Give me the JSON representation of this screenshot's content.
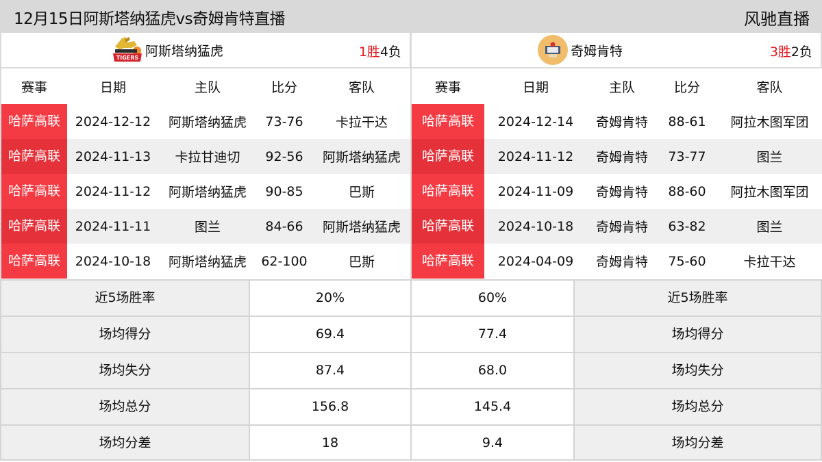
{
  "header": {
    "title": "12月15日阿斯塔纳猛虎vs奇姆肯特直播",
    "brand": "风驰直播"
  },
  "teams": {
    "left": {
      "name": "阿斯塔纳猛虎",
      "logo_icon": "astana-tigers-logo-icon",
      "record_win": "1胜",
      "record_loss": "4负"
    },
    "right": {
      "name": "奇姆肯特",
      "logo_icon": "shymkent-logo-icon",
      "record_win": "3胜",
      "record_loss": "2负"
    }
  },
  "colors": {
    "league_badge": "#f43b43",
    "win_text": "#e8141b",
    "header_bg": "#d9d9d9",
    "alt_row": "#efefef"
  },
  "columns": [
    "赛事",
    "日期",
    "主队",
    "比分",
    "客队"
  ],
  "left_matches": [
    {
      "league": "哈萨高联",
      "date": "2024-12-12",
      "home": "阿斯塔纳猛虎",
      "score": "73-76",
      "away": "卡拉干达"
    },
    {
      "league": "哈萨高联",
      "date": "2024-11-13",
      "home": "卡拉甘迪切",
      "score": "92-56",
      "away": "阿斯塔纳猛虎"
    },
    {
      "league": "哈萨高联",
      "date": "2024-11-12",
      "home": "阿斯塔纳猛虎",
      "score": "90-85",
      "away": "巴斯"
    },
    {
      "league": "哈萨高联",
      "date": "2024-11-11",
      "home": "图兰",
      "score": "84-66",
      "away": "阿斯塔纳猛虎"
    },
    {
      "league": "哈萨高联",
      "date": "2024-10-18",
      "home": "阿斯塔纳猛虎",
      "score": "62-100",
      "away": "巴斯"
    }
  ],
  "right_matches": [
    {
      "league": "哈萨高联",
      "date": "2024-12-14",
      "home": "奇姆肯特",
      "score": "88-61",
      "away": "阿拉木图军团"
    },
    {
      "league": "哈萨高联",
      "date": "2024-11-12",
      "home": "奇姆肯特",
      "score": "73-77",
      "away": "图兰"
    },
    {
      "league": "哈萨高联",
      "date": "2024-11-09",
      "home": "奇姆肯特",
      "score": "88-60",
      "away": "阿拉木图军团"
    },
    {
      "league": "哈萨高联",
      "date": "2024-10-18",
      "home": "奇姆肯特",
      "score": "63-82",
      "away": "图兰"
    },
    {
      "league": "哈萨高联",
      "date": "2024-04-09",
      "home": "奇姆肯特",
      "score": "75-60",
      "away": "卡拉干达"
    }
  ],
  "stats": [
    {
      "label": "近5场胜率",
      "left": "20%",
      "right": "60%"
    },
    {
      "label": "场均得分",
      "left": "69.4",
      "right": "77.4"
    },
    {
      "label": "场均失分",
      "left": "87.4",
      "right": "68.0"
    },
    {
      "label": "场均总分",
      "left": "156.8",
      "right": "145.4"
    },
    {
      "label": "场均分差",
      "left": "18",
      "right": "9.4"
    }
  ]
}
